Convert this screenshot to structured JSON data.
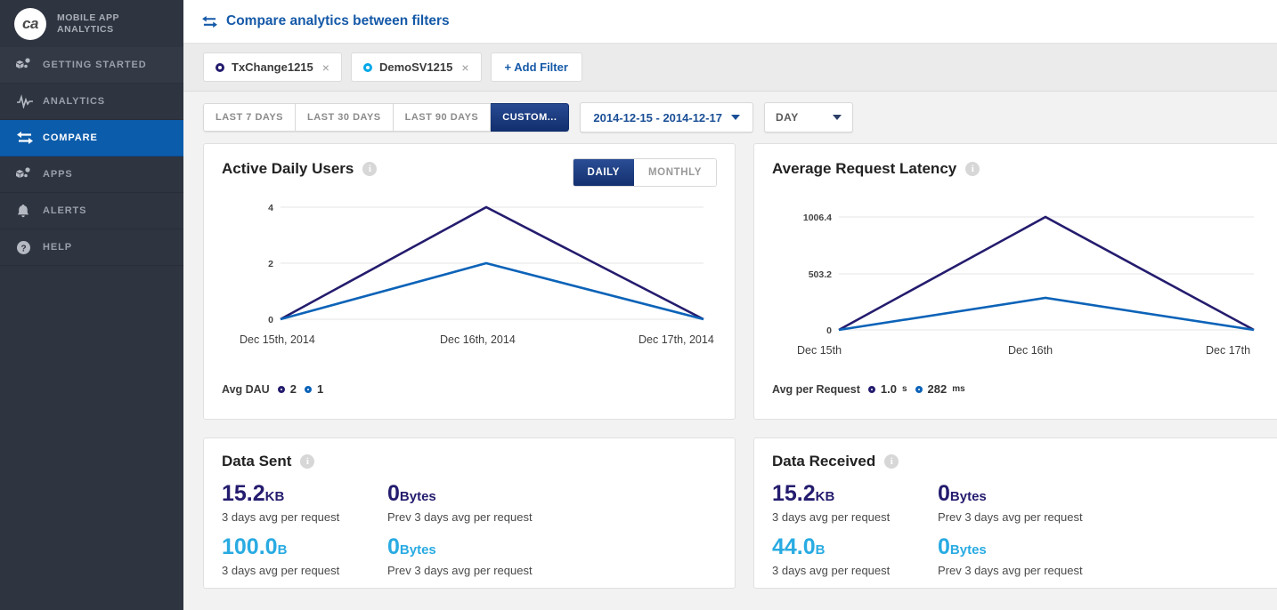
{
  "brand": {
    "logo_text": "ca",
    "name_line1": "MOBILE APP",
    "name_line2": "ANALYTICS"
  },
  "sidebar": {
    "items": [
      {
        "label": "GETTING STARTED",
        "icon": "cubes-icon"
      },
      {
        "label": "ANALYTICS",
        "icon": "pulse-icon"
      },
      {
        "label": "COMPARE",
        "icon": "compare-arrows-icon"
      },
      {
        "label": "APPS",
        "icon": "cubes-icon"
      },
      {
        "label": "ALERTS",
        "icon": "bell-icon"
      },
      {
        "label": "HELP",
        "icon": "question-circle-icon"
      }
    ]
  },
  "topbar": {
    "title": "Compare analytics between filters",
    "icon": "compare-arrows-icon"
  },
  "filters": {
    "chips": [
      {
        "label": "TxChange1215",
        "dot_color": "#241c6e",
        "close": "×"
      },
      {
        "label": "DemoSV1215",
        "dot_color": "#00a8e8",
        "close": "×"
      }
    ],
    "add_label": "+ Add Filter"
  },
  "range": {
    "presets": [
      {
        "label": "LAST 7 DAYS",
        "active": false
      },
      {
        "label": "LAST 30 DAYS",
        "active": false
      },
      {
        "label": "LAST 90 DAYS",
        "active": false
      },
      {
        "label": "CUSTOM...",
        "active": true
      }
    ],
    "date_range": "2014-12-15 - 2014-12-17",
    "granularity": "DAY"
  },
  "cards": {
    "active_daily_users": {
      "title": "Active Daily Users",
      "info": "i",
      "toggle": [
        {
          "label": "DAILY",
          "active": true
        },
        {
          "label": "MONTHLY",
          "active": false
        }
      ],
      "legend_label": "Avg DAU",
      "legend": [
        {
          "value": "2",
          "unit": "",
          "color": "#241c6e"
        },
        {
          "value": "1",
          "unit": "",
          "color": "#0c63b8"
        }
      ]
    },
    "average_request_latency": {
      "title": "Average Request Latency",
      "info": "i",
      "legend_label": "Avg per Request",
      "legend": [
        {
          "value": "1.0",
          "unit": "s",
          "color": "#241c6e"
        },
        {
          "value": "282",
          "unit": "ms",
          "color": "#0c63b8"
        }
      ]
    },
    "data_sent": {
      "title": "Data Sent",
      "info": "i",
      "stats": [
        {
          "value": "15.2",
          "unit": "KB",
          "caption": "3 days avg per request",
          "color": "#241c6e"
        },
        {
          "value": "0",
          "unit": "Bytes",
          "caption": "Prev 3 days avg per request",
          "color": "#241c6e"
        },
        {
          "value": "100.0",
          "unit": "B",
          "caption": "3 days avg per request",
          "color": "#29abe2"
        },
        {
          "value": "0",
          "unit": "Bytes",
          "caption": "Prev 3 days avg per request",
          "color": "#29abe2"
        }
      ]
    },
    "data_received": {
      "title": "Data Received",
      "info": "i",
      "stats": [
        {
          "value": "15.2",
          "unit": "KB",
          "caption": "3 days avg per request",
          "color": "#241c6e"
        },
        {
          "value": "0",
          "unit": "Bytes",
          "caption": "Prev 3 days avg per request",
          "color": "#241c6e"
        },
        {
          "value": "44.0",
          "unit": "B",
          "caption": "3 days avg per request",
          "color": "#29abe2"
        },
        {
          "value": "0",
          "unit": "Bytes",
          "caption": "Prev 3 days avg per request",
          "color": "#29abe2"
        }
      ]
    }
  },
  "chart_data": [
    {
      "type": "line",
      "title": "Active Daily Users",
      "x": [
        "Dec 15th, 2014",
        "Dec 16th, 2014",
        "Dec 17th, 2014"
      ],
      "xlabel": "",
      "ylabel": "",
      "ylim": [
        0,
        4
      ],
      "yticks": [
        0,
        2,
        4
      ],
      "ytick_labels": [
        "0",
        "2",
        "4"
      ],
      "grid": true,
      "legend_position": "bottom-left",
      "series": [
        {
          "name": "TxChange1215",
          "color": "#241c6e",
          "values": [
            0,
            4,
            0
          ]
        },
        {
          "name": "DemoSV1215",
          "color": "#0c63b8",
          "values": [
            0,
            2,
            0
          ]
        }
      ]
    },
    {
      "type": "line",
      "title": "Average Request Latency",
      "x": [
        "Dec 15th",
        "Dec 16th",
        "Dec 17th"
      ],
      "xlabel": "",
      "ylabel": "",
      "ylim": [
        0,
        1006.4
      ],
      "yticks": [
        0,
        503.2,
        1006.4
      ],
      "ytick_labels": [
        "0",
        "503.2",
        "1006.4"
      ],
      "grid": true,
      "legend_position": "bottom-left",
      "series": [
        {
          "name": "TxChange1215",
          "color": "#241c6e",
          "values": [
            0,
            1006.4,
            0
          ]
        },
        {
          "name": "DemoSV1215",
          "color": "#0c63b8",
          "values": [
            0,
            282,
            0
          ]
        }
      ]
    }
  ]
}
